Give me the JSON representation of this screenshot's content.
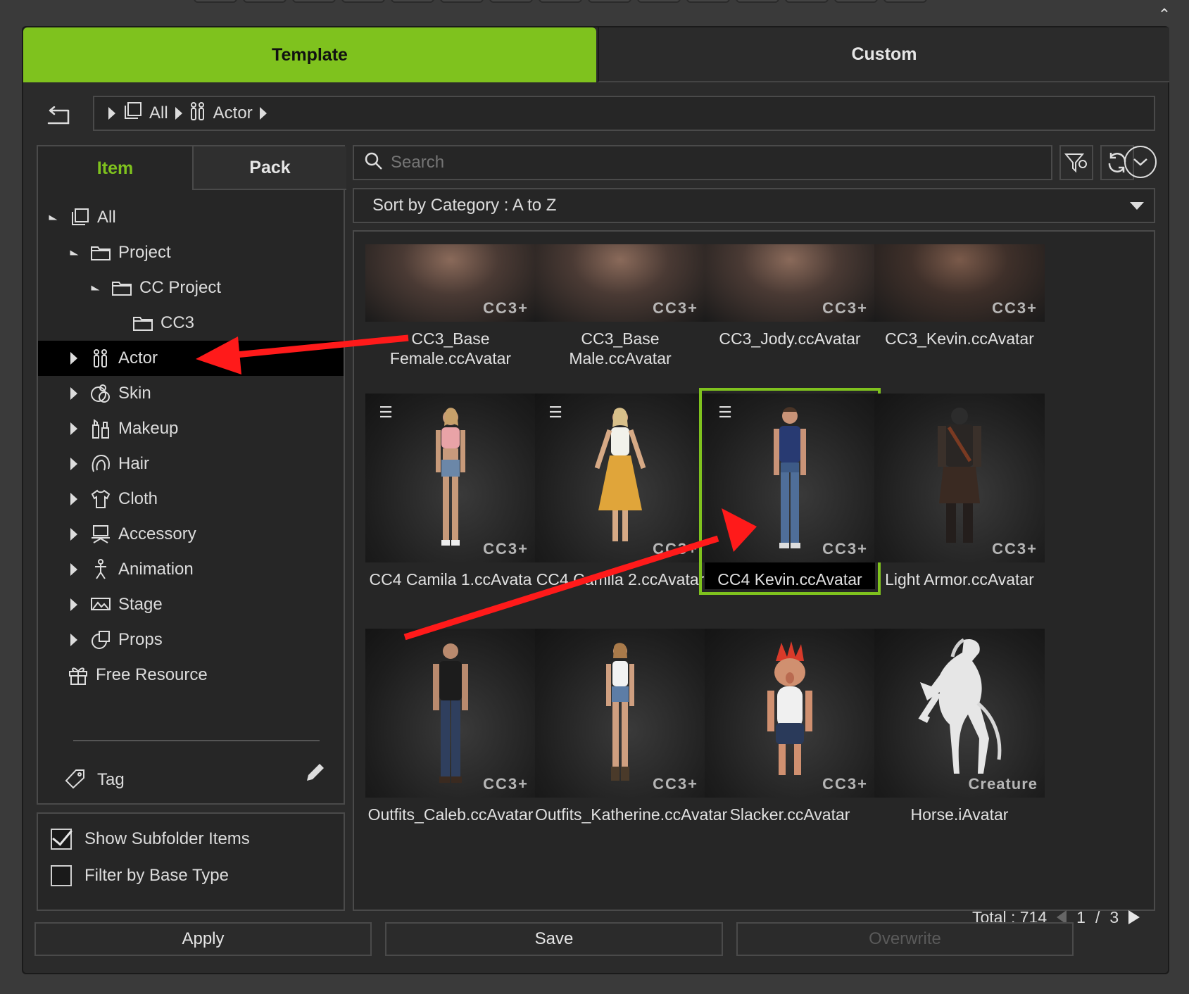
{
  "main_tabs": {
    "template": "Template",
    "custom": "Custom"
  },
  "breadcrumb": {
    "items": [
      "All",
      "Actor"
    ]
  },
  "left_panel": {
    "tabs": {
      "item": "Item",
      "pack": "Pack"
    },
    "tree": [
      {
        "label": "All",
        "icon": "square-stack-icon",
        "level": 0,
        "expanded": true
      },
      {
        "label": "Project",
        "icon": "folder-icon",
        "level": 1,
        "expanded": true
      },
      {
        "label": "CC Project",
        "icon": "folder-icon",
        "level": 2,
        "expanded": true
      },
      {
        "label": "CC3",
        "icon": "folder-icon",
        "level": 3
      },
      {
        "label": "Actor",
        "icon": "actor-icon",
        "level": 1,
        "selected": true
      },
      {
        "label": "Skin",
        "icon": "skin-icon",
        "level": 1
      },
      {
        "label": "Makeup",
        "icon": "makeup-icon",
        "level": 1
      },
      {
        "label": "Hair",
        "icon": "hair-icon",
        "level": 1
      },
      {
        "label": "Cloth",
        "icon": "cloth-icon",
        "level": 1
      },
      {
        "label": "Accessory",
        "icon": "accessory-icon",
        "level": 1
      },
      {
        "label": "Animation",
        "icon": "animation-icon",
        "level": 1
      },
      {
        "label": "Stage",
        "icon": "stage-icon",
        "level": 1
      },
      {
        "label": "Props",
        "icon": "props-icon",
        "level": 1
      },
      {
        "label": "Free Resource",
        "icon": "gift-icon",
        "level": 0
      }
    ],
    "tag_label": "Tag",
    "options": {
      "show_subfolder": "Show Subfolder Items",
      "filter_base": "Filter by Base Type"
    },
    "options_state": {
      "show_subfolder": true,
      "filter_base": false
    }
  },
  "search": {
    "placeholder": "Search"
  },
  "sort": {
    "label": "Sort by Category : A to Z"
  },
  "items": [
    {
      "label": "CC3_Base Female.ccAvatar",
      "badge": "CC3+",
      "kind": "head"
    },
    {
      "label": "CC3_Base Male.ccAvatar",
      "badge": "CC3+",
      "kind": "head"
    },
    {
      "label": "CC3_Jody.ccAvatar",
      "badge": "CC3+",
      "kind": "head"
    },
    {
      "label": "CC3_Kevin.ccAvatar",
      "badge": "CC3+",
      "kind": "head"
    },
    {
      "label": "CC4 Camila 1.ccAvata",
      "badge": "CC3+",
      "kind": "body",
      "menu": true
    },
    {
      "label": "CC4 Camila 2.ccAvatar",
      "badge": "CC3+",
      "kind": "body",
      "menu": true
    },
    {
      "label": "CC4 Kevin.ccAvatar",
      "badge": "CC3+",
      "kind": "body",
      "menu": true,
      "selected": true
    },
    {
      "label": "Light Armor.ccAvatar",
      "badge": "CC3+",
      "kind": "body"
    },
    {
      "label": "Outfits_Caleb.ccAvatar",
      "badge": "CC3+",
      "kind": "body"
    },
    {
      "label": "Outfits_Katherine.ccAvatar",
      "badge": "CC3+",
      "kind": "body"
    },
    {
      "label": "Slacker.ccAvatar",
      "badge": "CC3+",
      "kind": "body"
    },
    {
      "label": "Horse.iAvatar",
      "badge": "Creature",
      "kind": "body"
    }
  ],
  "footer": {
    "total": "Total : 714",
    "page": "1",
    "sep": "/",
    "pages": "3"
  },
  "buttons": {
    "apply": "Apply",
    "save": "Save",
    "overwrite": "Overwrite"
  },
  "colors": {
    "accent": "#7fc21e",
    "annotation_arrow": "#ff0000"
  }
}
